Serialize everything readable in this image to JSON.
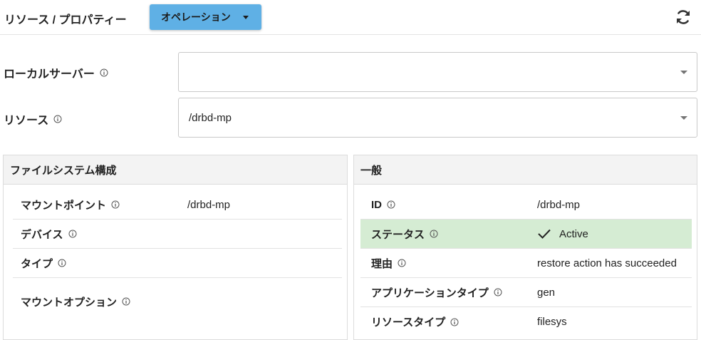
{
  "header": {
    "breadcrumb": "リソース / プロパティー",
    "operations_label": "オペレーション",
    "refresh_icon": "refresh-icon"
  },
  "form": {
    "local_server": {
      "label": "ローカルサーバー",
      "value": ""
    },
    "resource": {
      "label": "リソース",
      "value": "/drbd-mp"
    }
  },
  "filesystem_panel": {
    "title": "ファイルシステム構成",
    "rows": [
      {
        "label": "マウントポイント",
        "value": "/drbd-mp"
      },
      {
        "label": "デバイス",
        "value": ""
      },
      {
        "label": "タイプ",
        "value": ""
      },
      {
        "label": "マウントオプション",
        "value": ""
      }
    ]
  },
  "general_panel": {
    "title": "一般",
    "rows": [
      {
        "label": "ID",
        "value": "/drbd-mp"
      },
      {
        "label": "ステータス",
        "value": "Active"
      },
      {
        "label": "理由",
        "value": "restore action has succeeded"
      },
      {
        "label": "アプリケーションタイプ",
        "value": "gen"
      },
      {
        "label": "リソースタイプ",
        "value": "filesys"
      }
    ]
  },
  "colors": {
    "accent_button": "#5fb0e5",
    "status_active_bg": "#d5ecd3",
    "panel_header_bg": "#f3f3f3"
  }
}
